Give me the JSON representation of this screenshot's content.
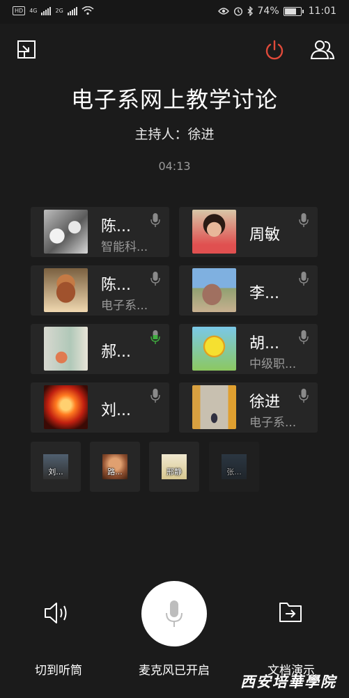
{
  "status_bar": {
    "hd_badge": "HD",
    "signal1": "4G",
    "signal2": "2G",
    "battery": "74%",
    "battery_level": 0.74,
    "time": "11:01"
  },
  "meeting": {
    "title": "电子系网上教学讨论",
    "host_line": "主持人：徐进",
    "timer": "04:13"
  },
  "participants": [
    {
      "name": "陈...",
      "org": "智能科...",
      "mic": "idle"
    },
    {
      "name": "周敏",
      "org": "",
      "mic": "idle"
    },
    {
      "name": "陈...",
      "org": "电子系...",
      "mic": "idle"
    },
    {
      "name": "李...",
      "org": "",
      "mic": "idle"
    },
    {
      "name": "郝...",
      "org": "",
      "mic": "speaking"
    },
    {
      "name": "胡...",
      "org": "中级职...",
      "mic": "idle"
    },
    {
      "name": "刘...",
      "org": "",
      "mic": "idle"
    },
    {
      "name": "徐进",
      "org": "电子系...",
      "mic": "idle"
    }
  ],
  "small_participants": [
    {
      "label": "刘..."
    },
    {
      "label": "路..."
    },
    {
      "label": "邢静"
    },
    {
      "label": "张..."
    }
  ],
  "controls": {
    "speaker_label": "切到听筒",
    "mic_label": "麦克风已开启",
    "doc_label": "文档演示"
  },
  "watermark": "西安培華學院",
  "colors": {
    "background": "#1b1b1b",
    "card": "#262626",
    "end_button": "#e04a3a",
    "speaking_mic": "#3fae3f"
  },
  "icons": [
    "minimize-icon",
    "power-icon",
    "members-icon",
    "microphone-icon",
    "speaker-icon",
    "share-document-icon"
  ]
}
